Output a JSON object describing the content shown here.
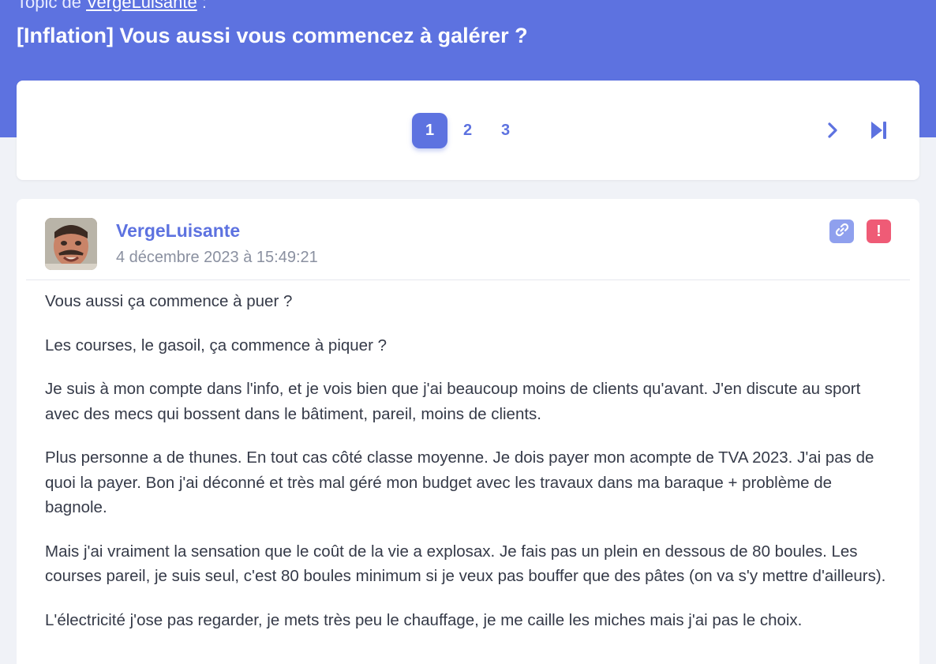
{
  "topic": {
    "prefix": "Topic de",
    "author_link": "VergeLuisante",
    "suffix": " :",
    "title": "[Inflation] Vous aussi vous commencez à galérer ?"
  },
  "pagination": {
    "pages": [
      "1",
      "2",
      "3"
    ],
    "current": "1",
    "next_icon": "chevron-right-icon",
    "last_icon": "skip-to-end-icon"
  },
  "post": {
    "author": "VergeLuisante",
    "date": "4 décembre 2023 à 15:49:21",
    "actions": {
      "link_icon": "link-icon",
      "report_label": "!"
    },
    "paragraphs": [
      "Vous aussi ça commence à puer ?",
      "Les courses, le gasoil, ça commence à piquer ?",
      "Je suis à mon compte dans l'info, et je vois bien que j'ai beaucoup moins de clients qu'avant. J'en discute au sport avec des mecs qui bossent dans le bâtiment, pareil, moins de clients.",
      "Plus personne a de thunes. En tout cas côté classe moyenne. Je dois payer mon acompte de TVA 2023. J'ai pas de quoi la payer. Bon j'ai déconné et très mal géré mon budget avec les travaux dans ma baraque + problème de bagnole.",
      "Mais j'ai vraiment la sensation que le coût de la vie a explosax. Je fais pas un plein en dessous de 80 boules. Les courses pareil, je suis seul, c'est 80 boules minimum si je veux pas bouffer que des pâtes (on va s'y mettre d'ailleurs).",
      "L'électricité j'ose pas regarder, je mets très peu le chauffage, je me caille les miches mais j'ai pas le choix."
    ]
  },
  "colors": {
    "accent": "#5d72e0",
    "report": "#ef5b76",
    "link_button": "#8fa0ee"
  }
}
